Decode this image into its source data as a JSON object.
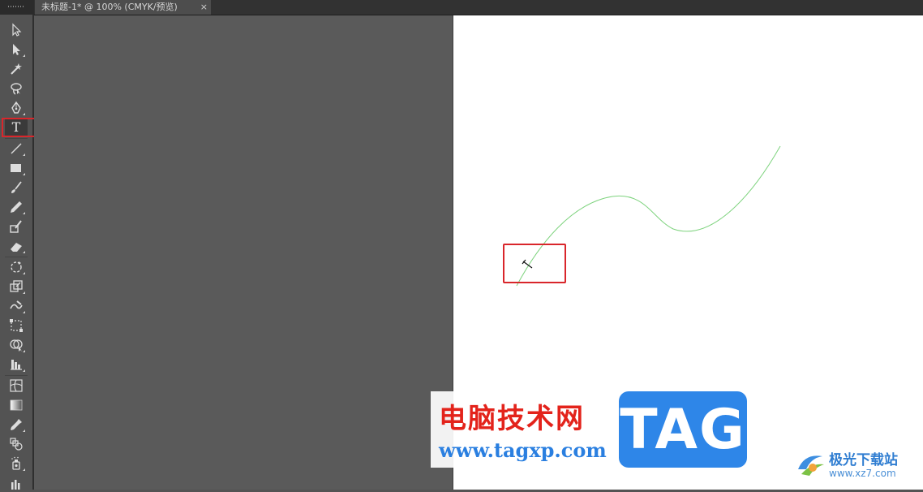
{
  "document_tab": {
    "title": "未标题-1* @ 100% (CMYK/预览)",
    "close_glyph": "×"
  },
  "toolbar": {
    "tools": [
      {
        "name": "selection-tool",
        "icon": "selection-arrow-icon"
      },
      {
        "name": "direct-selection-tool",
        "icon": "direct-selection-arrow-icon"
      },
      {
        "name": "magic-wand-tool",
        "icon": "magic-wand-icon"
      },
      {
        "name": "lasso-tool",
        "icon": "lasso-icon"
      },
      {
        "name": "pen-tool",
        "icon": "pen-nib-icon"
      },
      {
        "name": "type-tool",
        "icon": "type-icon",
        "label": "T",
        "active": true
      },
      {
        "name": "line-segment-tool",
        "icon": "line-icon"
      },
      {
        "name": "rectangle-tool",
        "icon": "rectangle-icon"
      },
      {
        "name": "paintbrush-tool",
        "icon": "brush-icon"
      },
      {
        "name": "pencil-tool",
        "icon": "pencil-icon"
      },
      {
        "name": "blob-brush-tool",
        "icon": "blob-brush-icon"
      },
      {
        "name": "eraser-tool",
        "icon": "eraser-icon"
      },
      {
        "name": "rotate-tool",
        "icon": "rotate-icon"
      },
      {
        "name": "scale-tool",
        "icon": "scale-icon"
      },
      {
        "name": "warp-tool",
        "icon": "warp-icon"
      },
      {
        "name": "free-transform-tool",
        "icon": "free-transform-icon"
      },
      {
        "name": "shape-builder-tool",
        "icon": "shape-builder-icon"
      },
      {
        "name": "graph-tool",
        "icon": "column-graph-icon"
      },
      {
        "name": "mesh-tool",
        "icon": "mesh-icon"
      },
      {
        "name": "gradient-tool",
        "icon": "gradient-icon"
      },
      {
        "name": "eyedropper-tool",
        "icon": "eyedropper-icon"
      },
      {
        "name": "blend-tool",
        "icon": "blend-icon"
      },
      {
        "name": "symbol-sprayer-tool",
        "icon": "symbol-sprayer-icon"
      },
      {
        "name": "column-graph-tool",
        "icon": "bar-graph-icon"
      }
    ]
  },
  "canvas": {
    "path_color": "#7ed37e",
    "highlight_color": "#d9262b"
  },
  "watermark": {
    "site_name": "电脑技术网",
    "site_url": "www.tagxp.com",
    "badge_text": "TAG",
    "corner_logo_name": "极光下载站",
    "corner_logo_url": "www.xz7.com"
  }
}
